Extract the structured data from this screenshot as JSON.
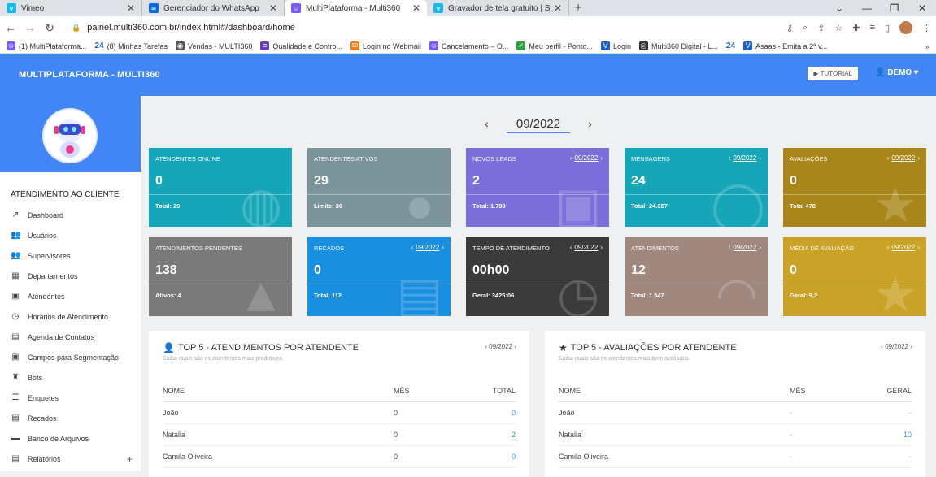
{
  "browser": {
    "tabs": [
      {
        "title": "Vimeo",
        "icon": "vimeo-icon",
        "color": "#1ab7ea"
      },
      {
        "title": "Gerenciador do WhatsApp",
        "icon": "meta-icon",
        "color": "#0668e1"
      },
      {
        "title": "MultiPlataforma - Multi360",
        "icon": "robot-icon",
        "color": "#7a5af8"
      },
      {
        "title": "Gravador de tela gratuito | Softw",
        "icon": "vimeo-icon",
        "color": "#1ab7ea"
      }
    ],
    "url": "painel.multi360.com.br/index.html#/dashboard/home",
    "bookmarks": [
      "(1) MultiPlataforma...",
      "(8) Minhas Tarefas",
      "Vendas - MULTI360",
      "Qualidade e Contro...",
      "Login no Webmail",
      "Cancelamento – O...",
      "Meu perfil - Ponto...",
      "Login",
      "Multi360 Digital - L...",
      "Asaas - Emita a 2ª v..."
    ],
    "bookmark_badge": "24"
  },
  "header": {
    "brand": "MULTIPLATAFORMA - MULTI360",
    "tutorial": "TUTORIAL",
    "user": "DEMO"
  },
  "sidebar": {
    "section": "ATENDIMENTO AO CLIENTE",
    "items": [
      {
        "label": "Dashboard",
        "icon": "trending-icon"
      },
      {
        "label": "Usuários",
        "icon": "users-icon"
      },
      {
        "label": "Supervisores",
        "icon": "supervisors-icon"
      },
      {
        "label": "Departamentos",
        "icon": "department-icon"
      },
      {
        "label": "Atendentes",
        "icon": "agents-icon"
      },
      {
        "label": "Horários de Atendimento",
        "icon": "clock-icon"
      },
      {
        "label": "Agenda de Contatos",
        "icon": "contacts-icon"
      },
      {
        "label": "Campos para Segmentação",
        "icon": "fields-icon"
      },
      {
        "label": "Bots",
        "icon": "robot-icon"
      },
      {
        "label": "Enquetes",
        "icon": "list-icon"
      },
      {
        "label": "Recados",
        "icon": "clipboard-icon"
      },
      {
        "label": "Banco de Arquivos",
        "icon": "folder-icon"
      },
      {
        "label": "Relatórios",
        "icon": "report-icon"
      }
    ]
  },
  "period": "09/2022",
  "cards": [
    {
      "label": "ATENDENTES ONLINE",
      "value": "0",
      "foot": "Total: 29",
      "color": "#17a6b8",
      "period": ""
    },
    {
      "label": "ATENDENTES ATIVOS",
      "value": "29",
      "foot": "Limite: 30",
      "color": "#7b949c",
      "period": ""
    },
    {
      "label": "NOVOS LEADS",
      "value": "2",
      "foot": "Total: 1.790",
      "color": "#7c6fd9",
      "period": "09/2022"
    },
    {
      "label": "MENSAGENS",
      "value": "24",
      "foot": "Total: 24.657",
      "color": "#17a6b8",
      "period": "09/2022"
    },
    {
      "label": "AVALIAÇÕES",
      "value": "0",
      "foot": "Total 478",
      "color": "#a8861a",
      "period": "09/2022"
    },
    {
      "label": "ATENDIMENTOS PENDENTES",
      "value": "138",
      "foot": "Ativos: 4",
      "color": "#7a7a7a",
      "period": ""
    },
    {
      "label": "RECADOS",
      "value": "0",
      "foot": "Total: 112",
      "color": "#1a8fe0",
      "period": "09/2022"
    },
    {
      "label": "TEMPO DE ATENDIMENTO",
      "value": "00h00",
      "foot": "Geral: 3425:06",
      "color": "#3b3b3b",
      "period": "09/2022"
    },
    {
      "label": "ATENDIMENTOS",
      "value": "12",
      "foot": "Total: 1.547",
      "color": "#a1887f",
      "period": "09/2022"
    },
    {
      "label": "MÉDIA DE AVALIAÇÃO",
      "value": "0",
      "foot": "Geral: 9,2",
      "color": "#c9a227",
      "period": "09/2022"
    }
  ],
  "top_attend": {
    "title": "TOP 5 - ATENDIMENTOS POR ATENDENTE",
    "subtitle": "Saiba quais são os atendentes mais produtivos.",
    "period": "09/2022",
    "headers": [
      "NOME",
      "MÊS",
      "TOTAL"
    ],
    "rows": [
      [
        "João",
        "0",
        "0"
      ],
      [
        "Natalia",
        "0",
        "2"
      ],
      [
        "Camila Oliveira",
        "0",
        "0"
      ]
    ]
  },
  "top_ratings": {
    "title": "TOP 5 - AVALIAÇÕES POR ATENDENTE",
    "subtitle": "Saiba quais são os atendentes mais bem avaliados.",
    "period": "09/2022",
    "headers": [
      "NOME",
      "MÊS",
      "GERAL"
    ],
    "rows": [
      [
        "João",
        "-",
        "-"
      ],
      [
        "Natalia",
        "-",
        "10"
      ],
      [
        "Camila Oliveira",
        "-",
        "-"
      ]
    ]
  }
}
